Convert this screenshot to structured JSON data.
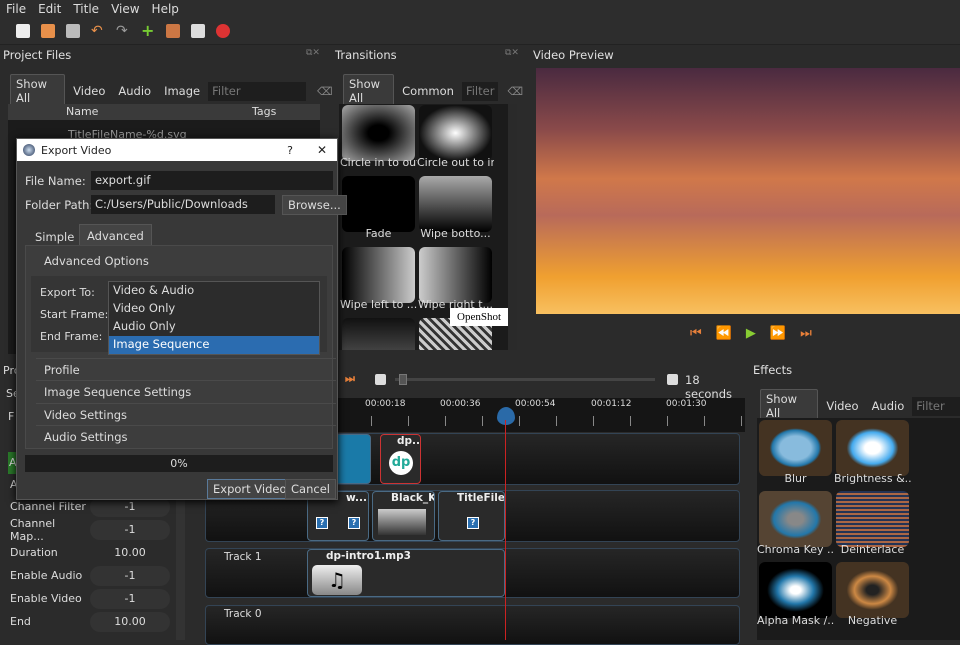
{
  "menu": [
    "File",
    "Edit",
    "Title",
    "View",
    "Help"
  ],
  "project_files": {
    "title": "Project Files",
    "filters": [
      "Show All",
      "Video",
      "Audio",
      "Image"
    ],
    "filter_placeholder": "Filter",
    "columns": [
      "Name",
      "Tags"
    ],
    "row_partial": "TitleFileName-%d.svg"
  },
  "transitions": {
    "title": "Transitions",
    "filters": [
      "Show All",
      "Common"
    ],
    "filter_placeholder": "Filter",
    "items": [
      "Circle in to out",
      "Circle out to in",
      "Fade",
      "Wipe botto...",
      "Wipe left to ...",
      "Wipe right t..."
    ],
    "tooltip": "OpenShot"
  },
  "preview": {
    "title": "Video Preview"
  },
  "effects": {
    "title": "Effects",
    "filters": [
      "Show All",
      "Video",
      "Audio"
    ],
    "filter_placeholder": "Filter",
    "items": [
      "Blur",
      "Brightness &...",
      "Chroma Key ...",
      "Deinterlace",
      "Alpha Mask /...",
      "Negative"
    ]
  },
  "timeline": {
    "zoom_label": "18 seconds",
    "ticks": [
      "00:00:18",
      "00:00:36",
      "00:00:54",
      "00:01:12",
      "00:01:30"
    ],
    "clips": [
      "dp...",
      "w...",
      "Black_K...",
      "TitleFile...",
      "dp-intro1.mp3"
    ],
    "tracks": [
      "Track 1",
      "Track 0"
    ]
  },
  "properties": {
    "partial": [
      "Pro",
      "Se",
      "F",
      "A",
      "A"
    ],
    "rows": [
      {
        "k": "Channel Filter",
        "v": "-1"
      },
      {
        "k": "Channel Map...",
        "v": "-1"
      },
      {
        "k": "Duration",
        "v": "10.00"
      },
      {
        "k": "Enable Audio",
        "v": "-1"
      },
      {
        "k": "Enable Video",
        "v": "-1"
      },
      {
        "k": "End",
        "v": "10.00"
      }
    ]
  },
  "dialog": {
    "title": "Export Video",
    "help": "?",
    "close": "✕",
    "file_name_label": "File Name:",
    "file_name": "export.gif",
    "folder_label": "Folder Path:",
    "folder": "C:/Users/Public/Downloads",
    "browse": "Browse...",
    "tabs": [
      "Simple",
      "Advanced"
    ],
    "advanced_options": "Advanced Options",
    "export_to_label": "Export To:",
    "start_frame_label": "Start Frame:",
    "end_frame_label": "End Frame:",
    "export_options": [
      "Video & Audio",
      "Video Only",
      "Audio Only",
      "Image Sequence"
    ],
    "sections": [
      "Profile",
      "Image Sequence Settings",
      "Video Settings",
      "Audio Settings"
    ],
    "progress": "0%",
    "progress_value": 0,
    "export_button": "Export Video",
    "cancel_button": "Cancel"
  }
}
